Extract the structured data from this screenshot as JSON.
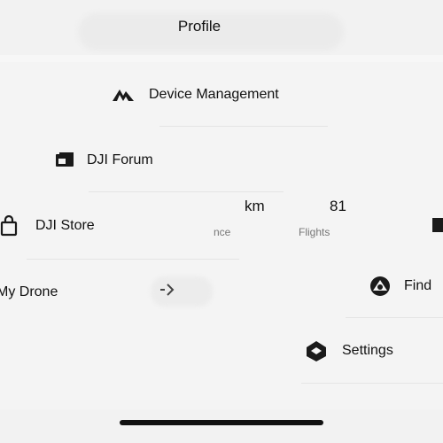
{
  "header": {
    "title": "Profile"
  },
  "menu": {
    "device_management": "Device Management",
    "dji_forum": "DJI Forum",
    "dji_store": "DJI Store",
    "my_drone": "My Drone",
    "find": "Find",
    "settings": "Settings"
  },
  "stats": {
    "distance_unit": "km",
    "distance_label": "nce",
    "flights_value": "81",
    "flights_label": "Flights"
  },
  "icons": {
    "device_management": "dji-logo-icon",
    "dji_forum": "forum-icon",
    "dji_store": "store-bag-icon",
    "find": "find-drone-icon",
    "settings": "settings-cube-icon",
    "chevron": "chevron-right-icon"
  },
  "colors": {
    "background": "#f4f4f4",
    "text": "#111111",
    "muted": "#777777"
  }
}
